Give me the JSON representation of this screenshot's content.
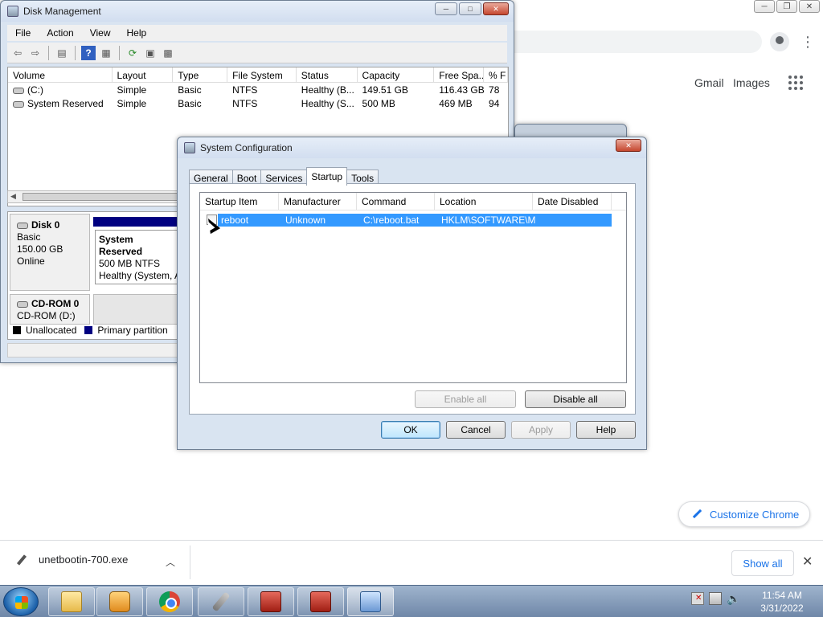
{
  "chrome": {
    "gmail": "Gmail",
    "images": "Images",
    "customize": "Customize Chrome",
    "download": {
      "filename": "unetbootin-700.exe",
      "show_all": "Show all"
    }
  },
  "disk_mgmt": {
    "title": "Disk Management",
    "menu": [
      "File",
      "Action",
      "View",
      "Help"
    ],
    "columns": [
      "Volume",
      "Layout",
      "Type",
      "File System",
      "Status",
      "Capacity",
      "Free Spa...",
      "% F"
    ],
    "rows": [
      [
        "(C:)",
        "Simple",
        "Basic",
        "NTFS",
        "Healthy (B...",
        "149.51 GB",
        "116.43 GB",
        "78"
      ],
      [
        "System Reserved",
        "Simple",
        "Basic",
        "NTFS",
        "Healthy (S...",
        "500 MB",
        "469 MB",
        "94"
      ]
    ],
    "disk0": {
      "name": "Disk 0",
      "type": "Basic",
      "size": "150.00 GB",
      "state": "Online"
    },
    "partition": {
      "name": "System Reserved",
      "size": "500 MB NTFS",
      "status": "Healthy (System, A"
    },
    "cdrom": {
      "name": "CD-ROM 0",
      "drive": "CD-ROM (D:)"
    },
    "legend": {
      "unallocated": "Unallocated",
      "primary": "Primary partition"
    }
  },
  "msconfig": {
    "title": "System Configuration",
    "tabs": [
      "General",
      "Boot",
      "Services",
      "Startup",
      "Tools"
    ],
    "active_tab": "Startup",
    "columns": [
      "Startup Item",
      "Manufacturer",
      "Command",
      "Location",
      "Date Disabled"
    ],
    "row": {
      "item": "reboot",
      "manufacturer": "Unknown",
      "command": "C:\\reboot.bat",
      "location": "HKLM\\SOFTWARE\\M...",
      "date_disabled": "",
      "checked": false
    },
    "buttons": {
      "enable_all": "Enable all",
      "disable_all": "Disable all",
      "ok": "OK",
      "cancel": "Cancel",
      "apply": "Apply",
      "help": "Help"
    }
  },
  "taskbar": {
    "time": "11:54 AM",
    "date": "3/31/2022"
  },
  "colors": {
    "selection": "#3399ff",
    "primary_partition": "#000080",
    "link": "#1a73e8"
  }
}
